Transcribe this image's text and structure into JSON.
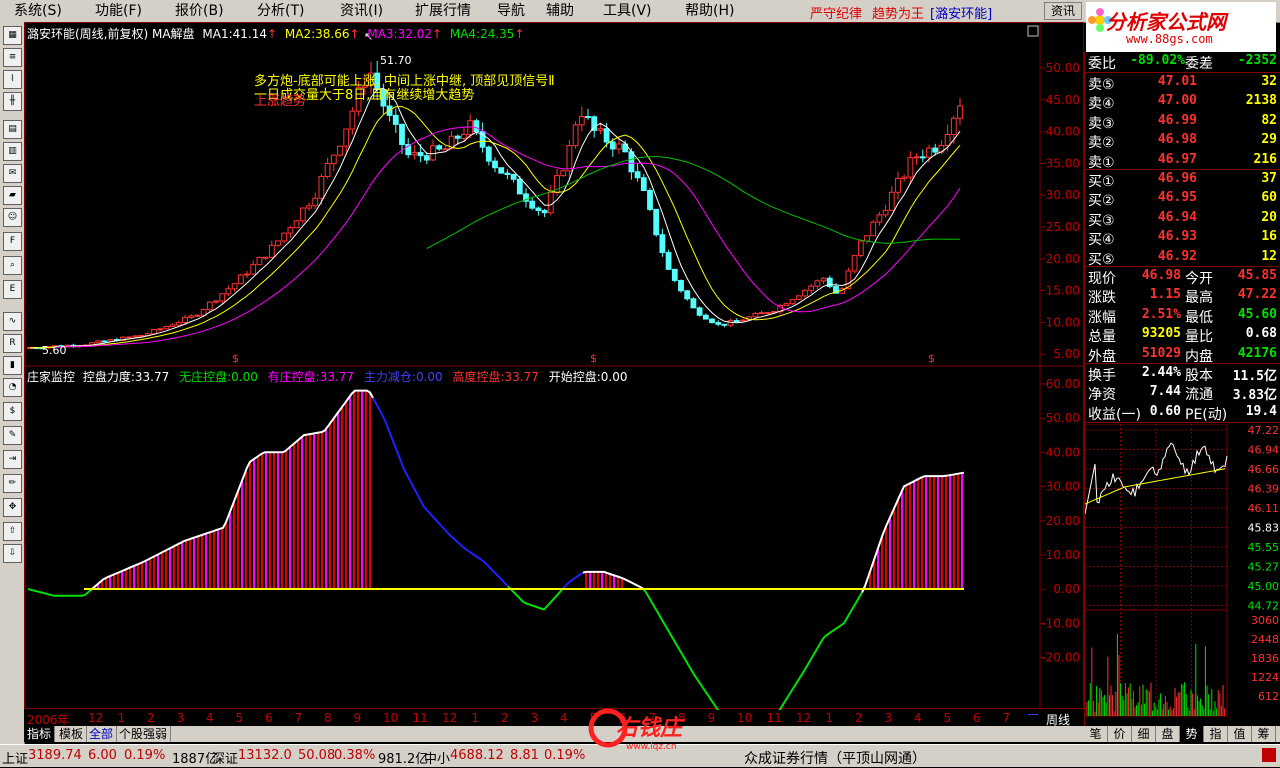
{
  "menu": [
    "系统(S)",
    "功能(F)",
    "报价(B)",
    "分析(T)",
    "资讯(I)",
    "扩展行情",
    "导航",
    "辅助",
    "工具(V)",
    "帮助(H)"
  ],
  "slogan": {
    "text1": "严守纪律",
    "text2": "趋势为王",
    "code": "[潞安环能]"
  },
  "search_btn": "资讯",
  "logo": {
    "title": "分析家公式网",
    "sub": "www.88gs.com"
  },
  "main_legend": {
    "title": "潞安环能(周线,前复权) MA解盘",
    "ma1": "MA1:41.14",
    "ma2": "MA2:38.66",
    "ma3": "MA3:32.02",
    "ma4": "MA4:24.35",
    "ma_colors": [
      "#ffffff",
      "#ffff00",
      "#ff00ff",
      "#00ff00"
    ]
  },
  "annotations": {
    "line1": "多方炮-底部可能上涨, 中间上涨中继, 顶部见顶信号Ⅱ",
    "line2": "一日成交量大于8日,且有继续增大趋势",
    "line3": "上涨趋势",
    "hi": "51.70",
    "lo": "5.60"
  },
  "price_axis": [
    "50.00",
    "45.00",
    "40.00",
    "35.00",
    "30.00",
    "25.00",
    "20.00",
    "15.00",
    "10.00",
    "5.00"
  ],
  "ind_legend": {
    "title": "庄家监控",
    "p1": "控盘力度:33.77",
    "p2": "无庄控盘:0.00",
    "p3": "有庄控盘:33.77",
    "p4": "主力减仓:0.00",
    "p5": "高度控盘:33.77",
    "p6": "开始控盘:0.00"
  },
  "ind_axis": [
    "60.00",
    "50.00",
    "40.00",
    "30.00",
    "20.00",
    "10.00",
    "0.00",
    "-10.00",
    "-20.00"
  ],
  "time_axis": {
    "year": "2006年",
    "months": [
      "12",
      "1",
      "2",
      "3",
      "4",
      "5",
      "6",
      "7",
      "8",
      "9",
      "10",
      "11",
      "12",
      "1",
      "2",
      "3",
      "4",
      "5",
      "6",
      "7",
      "8",
      "9",
      "10",
      "11",
      "12",
      "1",
      "2",
      "3",
      "4",
      "5",
      "6",
      "7"
    ],
    "period": "周线"
  },
  "right_panel": {
    "header": {
      "lbl1": "委比",
      "v1": "-89.02%",
      "lbl2": "委差",
      "v2": "-2352"
    },
    "sells": [
      {
        "lbl": "卖⑤",
        "p": "47.01",
        "v": "32"
      },
      {
        "lbl": "卖④",
        "p": "47.00",
        "v": "2138"
      },
      {
        "lbl": "卖③",
        "p": "46.99",
        "v": "82"
      },
      {
        "lbl": "卖②",
        "p": "46.98",
        "v": "29"
      },
      {
        "lbl": "卖①",
        "p": "46.97",
        "v": "216"
      }
    ],
    "buys": [
      {
        "lbl": "买①",
        "p": "46.96",
        "v": "37"
      },
      {
        "lbl": "买②",
        "p": "46.95",
        "v": "60"
      },
      {
        "lbl": "买③",
        "p": "46.94",
        "v": "20"
      },
      {
        "lbl": "买④",
        "p": "46.93",
        "v": "16"
      },
      {
        "lbl": "买⑤",
        "p": "46.92",
        "v": "12"
      }
    ],
    "quote": [
      {
        "l1": "现价",
        "v1": "46.98",
        "l2": "今开",
        "v2": "45.85"
      },
      {
        "l1": "涨跌",
        "v1": "1.15",
        "l2": "最高",
        "v2": "47.22"
      },
      {
        "l1": "涨幅",
        "v1": "2.51%",
        "l2": "最低",
        "v2": "45.60"
      },
      {
        "l1": "总量",
        "v1": "93205",
        "l2": "量比",
        "v2": "0.68"
      },
      {
        "l1": "外盘",
        "v1": "51029",
        "l2": "内盘",
        "v2": "42176"
      }
    ],
    "fund": [
      {
        "l1": "换手",
        "v1": "2.44%",
        "l2": "股本",
        "v2": "11.5亿"
      },
      {
        "l1": "净资",
        "v1": "7.44",
        "l2": "流通",
        "v2": "3.83亿"
      },
      {
        "l1": "收益(一)",
        "v1": "0.60",
        "l2": "PE(动)",
        "v2": "19.4"
      }
    ],
    "mini_axis": [
      "47.22",
      "46.94",
      "46.66",
      "46.39",
      "46.11",
      "45.83",
      "45.55",
      "45.27",
      "45.00",
      "44.72"
    ],
    "vol_axis": [
      "3060",
      "2448",
      "1836",
      "1224",
      "612"
    ],
    "tabs": [
      "笔",
      "价",
      "细",
      "盘",
      "势",
      "指",
      "值",
      "筹"
    ]
  },
  "bottom_tabs": [
    "指标",
    "模板",
    "全部",
    "个股强弱"
  ],
  "status": [
    {
      "lbl": "上证",
      "v": "3189.74",
      "c": "6.00",
      "p": "0.19%",
      "a": "1887亿"
    },
    {
      "lbl": "深证",
      "v": "13132.0",
      "c": "50.08",
      "p": "0.38%",
      "a": "981.2亿"
    },
    {
      "lbl": "中小",
      "v": "4688.12",
      "c": "8.81",
      "p": "0.19%",
      "a": ""
    }
  ],
  "status_tail": "众成证券行情（平顶山网通）",
  "watermark": {
    "text": "右钱庄",
    "url": "www.lqz.cn"
  }
}
